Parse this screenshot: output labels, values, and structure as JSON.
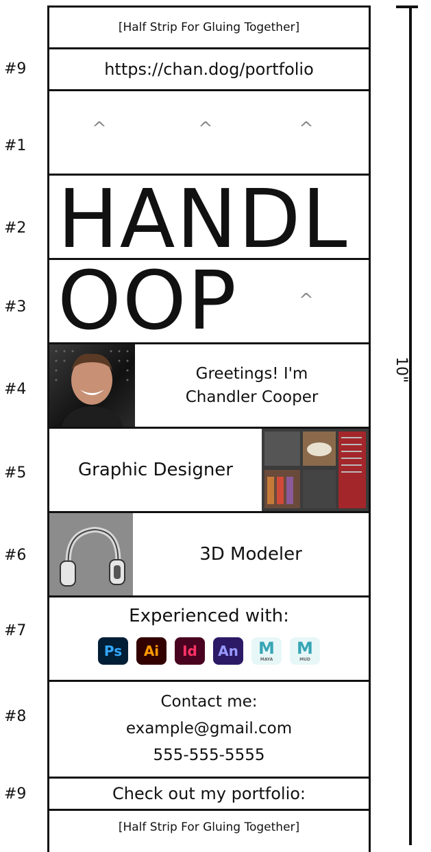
{
  "glue_top": "[Half Strip For Gluing Together]",
  "glue_bottom": "[Half Strip For Gluing Together]",
  "url_strip": "https://chan.dog/portfolio",
  "strip_numbers": [
    "#9",
    "#1",
    "#2",
    "#3",
    "#4",
    "#5",
    "#6",
    "#7",
    "#8",
    "#9"
  ],
  "caret_glyph": "^",
  "title_line1": "HANDL",
  "title_line2": "OOP",
  "greeting_line1": "Greetings! I'm",
  "greeting_line2": "Chandler Cooper",
  "role_graphic": "Graphic Designer",
  "role_3d": "3D Modeler",
  "experienced_label": "Experienced with:",
  "apps": [
    {
      "abbr": "Ps",
      "name": "photoshop-icon",
      "bg": "#001e36",
      "fg": "#31a8ff"
    },
    {
      "abbr": "Ai",
      "name": "illustrator-icon",
      "bg": "#330000",
      "fg": "#ff9a00"
    },
    {
      "abbr": "Id",
      "name": "indesign-icon",
      "bg": "#49021f",
      "fg": "#ff3366"
    },
    {
      "abbr": "An",
      "name": "animate-icon",
      "bg": "#2c1a66",
      "fg": "#9999ff"
    },
    {
      "abbr": "M",
      "name": "maya-icon",
      "bg": "#e7f7f8",
      "fg": "#37a5b5",
      "sub": "MAYA"
    },
    {
      "abbr": "M",
      "name": "mudbox-icon",
      "bg": "#e7f7f8",
      "fg": "#37a5b5",
      "sub": "MUD"
    }
  ],
  "contact_label": "Contact me:",
  "contact_email": "example@gmail.com",
  "contact_phone": "555-555-5555",
  "portfolio_cta": "Check out my portfolio:",
  "ruler_label": "10\""
}
